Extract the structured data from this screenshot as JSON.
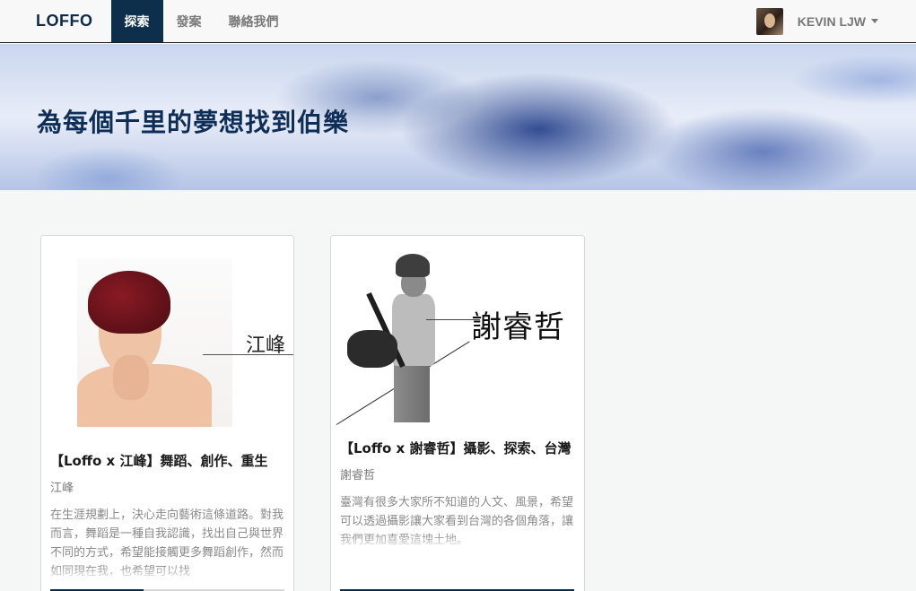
{
  "navbar": {
    "brand": "LOFFO",
    "items": [
      {
        "label": "探索",
        "active": true
      },
      {
        "label": "發案",
        "active": false
      },
      {
        "label": "聯絡我們",
        "active": false
      }
    ],
    "user": {
      "name": "KEVIN LJW"
    }
  },
  "hero": {
    "title": "為每個千里的夢想找到伯樂"
  },
  "cards": [
    {
      "image_caption": "江峰",
      "title": "【Loffo x 江峰】舞蹈、創作、重生",
      "author": "江峰",
      "description": "在生涯規劃上，決心走向藝術這條道路。對我而言，舞蹈是一種自我認識，找出自己與世界不同的方式，希望能接觸更多舞蹈創作，然而如同現在我，也希望可以找",
      "progress": 0.4
    },
    {
      "image_caption": "謝睿哲",
      "title": "【Loffo x 謝睿哲】攝影、探索、台灣",
      "author": "謝睿哲",
      "description": "臺灣有很多大家所不知道的人文、風景，希望可以透過攝影讓大家看到台灣的各個角落，讓我們更加喜愛這塊土地。",
      "progress": 1.0
    }
  ],
  "colors": {
    "nav_active": "#0d2f4c",
    "brand": "#0d2a4a",
    "hero_title": "#0e2e58",
    "progress_fill": "#0d2f4c"
  }
}
